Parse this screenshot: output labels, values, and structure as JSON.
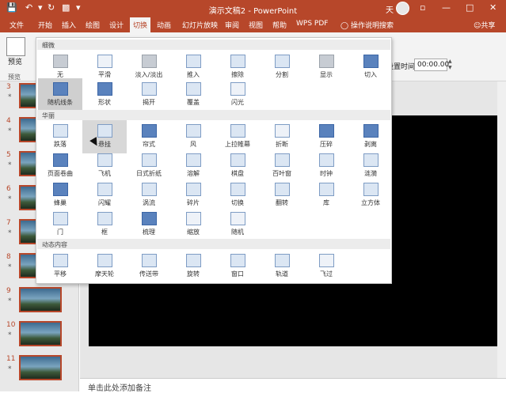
{
  "window": {
    "title": "演示文稿2 - PowerPoint",
    "user": "天"
  },
  "menu": {
    "tabs": [
      "文件",
      "开始",
      "插入",
      "绘图",
      "设计",
      "切换",
      "动画",
      "幻灯片放映",
      "审阅",
      "视图",
      "帮助",
      "WPS PDF"
    ],
    "active_tab": "切换",
    "search": "操作说明搜索",
    "share": "共享"
  },
  "ribbon": {
    "preview_label": "预览",
    "group_label": "预览",
    "timing_label": "设置时间:",
    "timing_value": "00:00.00"
  },
  "gallery": {
    "sections": [
      {
        "title": "细微",
        "items": [
          "无",
          "平滑",
          "淡入/淡出",
          "推入",
          "擦除",
          "分割",
          "显示",
          "切入",
          "随机线条",
          "形状",
          "揭开",
          "覆盖",
          "闪光"
        ]
      },
      {
        "title": "华丽",
        "items": [
          "跌落",
          "悬挂",
          "帘式",
          "风",
          "上拉帷幕",
          "折断",
          "压碎",
          "剥离",
          "页面卷曲",
          "飞机",
          "日式折纸",
          "溶解",
          "棋盘",
          "百叶窗",
          "时钟",
          "涟漪",
          "蜂巢",
          "闪耀",
          "涡流",
          "碎片",
          "切换",
          "翻转",
          "库",
          "立方体",
          "门",
          "框",
          "梳理",
          "缩放",
          "随机"
        ]
      },
      {
        "title": "动态内容",
        "items": [
          "平移",
          "摩天轮",
          "传送带",
          "旋转",
          "窗口",
          "轨道",
          "飞过"
        ]
      }
    ],
    "selected_item": "随机线条",
    "hovered_item": "悬挂"
  },
  "slides": {
    "numbers": [
      "3",
      "4",
      "5",
      "6",
      "7",
      "8",
      "9",
      "10",
      "11"
    ],
    "star": "*"
  },
  "notes": {
    "placeholder": "单击此处添加备注"
  },
  "colors": {
    "accent": "#b7472a",
    "icon_fill": "#5a82bd"
  }
}
